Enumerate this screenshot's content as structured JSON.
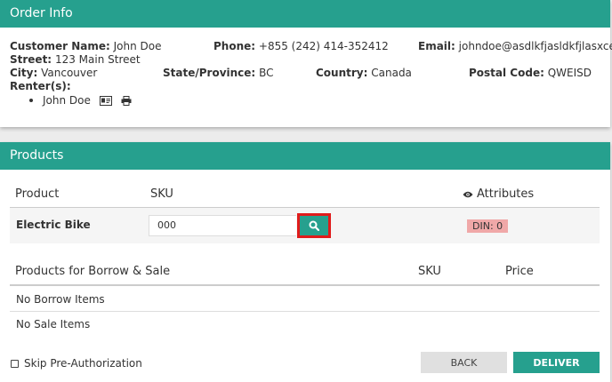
{
  "order_info": {
    "title": "Order Info",
    "customer_name_label": "Customer Name:",
    "customer_name": "John Doe",
    "phone_label": "Phone:",
    "phone": "+855 (242) 414-352412",
    "email_label": "Email:",
    "email": "johndoe@asdlkfjasldkfjlasxce.org",
    "street_label": "Street:",
    "street": "123 Main Street",
    "city_label": "City:",
    "city": "Vancouver",
    "state_label": "State/Province:",
    "state": "BC",
    "country_label": "Country:",
    "country": "Canada",
    "postal_label": "Postal Code:",
    "postal": "QWEISD",
    "renters_label": "Renter(s):",
    "renters": [
      "John Doe"
    ]
  },
  "products": {
    "title": "Products",
    "headers": {
      "product": "Product",
      "sku": "SKU",
      "attributes": "Attributes"
    },
    "item": {
      "name": "Electric Bike",
      "sku_value": "000",
      "attribute_badge": "DIN: 0"
    },
    "borrow_sale_headers": {
      "products": "Products for Borrow & Sale",
      "sku": "SKU",
      "price": "Price"
    },
    "no_borrow": "No Borrow Items",
    "no_sale": "No Sale Items"
  },
  "footer": {
    "skip_preauth_label": "Skip Pre-Authorization",
    "back_label": "BACK",
    "deliver_label": "DELIVER"
  },
  "colors": {
    "accent": "#26a08e",
    "highlight": "#e01b1b",
    "badge": "#f0a8a8"
  },
  "icons": {
    "renter_id": "id-card-icon",
    "renter_print": "printer-icon",
    "search": "search-icon",
    "attributes": "eye-icon"
  }
}
